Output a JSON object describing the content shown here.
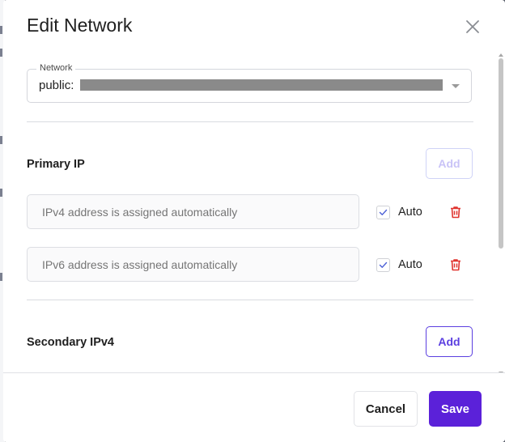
{
  "dialog": {
    "title": "Edit Network"
  },
  "network": {
    "legend": "Network",
    "value": "public:",
    "value_redacted": true
  },
  "primary_ip": {
    "label": "Primary IP",
    "add_label": "Add",
    "add_enabled": false,
    "rows": [
      {
        "placeholder": "IPv4 address is assigned automatically",
        "auto_checked": true,
        "auto_label": "Auto"
      },
      {
        "placeholder": "IPv6 address is assigned automatically",
        "auto_checked": true,
        "auto_label": "Auto"
      }
    ]
  },
  "secondary_ipv4": {
    "label": "Secondary IPv4",
    "add_label": "Add",
    "add_enabled": true
  },
  "footer": {
    "cancel_label": "Cancel",
    "save_label": "Save"
  },
  "colors": {
    "primary": "#5b21d9",
    "danger": "#e0342f",
    "check": "#4b5fd6"
  },
  "icons": {
    "close": "close-icon",
    "dropdown": "chevron-down-icon",
    "check": "checkmark-icon",
    "delete": "trash-icon"
  }
}
